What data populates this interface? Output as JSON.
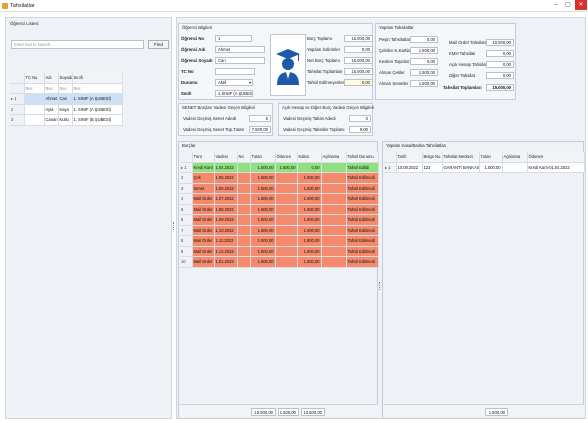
{
  "window": {
    "title": "Tahsilatlar",
    "minimize": "–",
    "maximize": "▢",
    "close": "✕"
  },
  "student_list": {
    "header": "Öğrenci Listesi",
    "search_placeholder": "Enter text to search...",
    "find_label": "Find",
    "columns": [
      "TC No",
      "Adı",
      "Soyadı",
      "Sınıfı"
    ],
    "filter_row": [
      "Rec",
      "Rec",
      "Rec",
      "Rec"
    ],
    "rows": [
      {
        "idx": "▸ 1",
        "tc": "",
        "ad": "Ahmet",
        "soyad": "Can",
        "sinif": "1. SINIF (A ŞUBESİ)"
      },
      {
        "idx": "2",
        "tc": "",
        "ad": "Ayla",
        "soyad": "Kaya",
        "sinif": "1. SINIF (A ŞUBESİ)"
      },
      {
        "idx": "3",
        "tc": "",
        "ad": "Canan",
        "soyad": "Kutlu",
        "sinif": "1. SINIF (B ŞUBESİ)"
      }
    ]
  },
  "student_info": {
    "header": "Öğrenci Bilgileri",
    "fields": [
      {
        "label": "Öğrenci No",
        "value": "1"
      },
      {
        "label": "Öğrenci Adı",
        "value": "Ahmet"
      },
      {
        "label": "Öğrenci Soyadı",
        "value": "Can"
      },
      {
        "label": "TC No",
        "value": ""
      },
      {
        "label": "Durumu",
        "value": "Aktif"
      },
      {
        "label": "Sınıfı",
        "value": "1.SINIF (A ŞUBESİ)"
      }
    ]
  },
  "debt_summary": [
    {
      "label": "Borç Toplamı",
      "value": "15.000,00"
    },
    {
      "label": "Yapılan İndirimler",
      "value": "0,00"
    },
    {
      "label": "Net Borç Toplamı",
      "value": "15.000,00"
    },
    {
      "label": "Tahsilat Toplamları",
      "value": "15.000,00"
    },
    {
      "label": "Tahsil Edilmeyenler",
      "value": "0,00"
    }
  ],
  "payments": {
    "header": "Yapılan Tahsilatlar",
    "left": [
      {
        "label": "Peşin Tahsilatlar",
        "value": "0,00"
      },
      {
        "label": "Çekilen K.Kartları",
        "value": "1.500,00"
      },
      {
        "label": "Kesilen Taşınlar",
        "value": "0,00"
      },
      {
        "label": "Alınan Çekler",
        "value": "1.500,00"
      },
      {
        "label": "Alınan Senetler",
        "value": "1.500,00"
      }
    ],
    "right": [
      {
        "label": "Mail Order Tahsilatı",
        "value": "10.500,00"
      },
      {
        "label": "KMH Tahsilatı",
        "value": "0,00"
      },
      {
        "label": "Açık Hesap Tahsilatı",
        "value": "0,00"
      },
      {
        "label": "Diğer Tahsilat",
        "value": "0,00"
      }
    ],
    "total_label": "Tahsilat Toplamları",
    "total_value": "15.000,00"
  },
  "senet": {
    "header": "SENET Borçları Vadesi Geçen Bilgileri",
    "rows": [
      {
        "label": "Vadesi Geçmiş Senet Adedi",
        "value": "5"
      },
      {
        "label": "Vadesi Geçmiş Senet Top.Tutarı",
        "value": "7.500,00"
      }
    ]
  },
  "open_account": {
    "header": "Açık Hesap ve Diğer Borç Vadesi Geçen Bilgileri",
    "rows": [
      {
        "label": "Vadesi Geçmiş Taksit Adedi",
        "value": "0"
      },
      {
        "label": "Vadesi Geçmiş Taksitler Toplamı",
        "value": "0,00"
      }
    ]
  },
  "debts": {
    "header": "Borçlar",
    "columns": [
      "Türü",
      "Vadesi",
      "No",
      "Tutarı",
      "Ödenen",
      "Kalan",
      "Açıklama",
      "Tahsil Durumu"
    ],
    "rows": [
      {
        "idx": "▸ 1",
        "tur": "Kredi Kartı",
        "vade": "1.04.2022",
        "no": "",
        "tutar": "1.500,00",
        "odenen": "1.500,00",
        "kalan": "0,00",
        "aciklama": "",
        "durum": "Tahsil Edildi",
        "status": "paid"
      },
      {
        "idx": "2",
        "tur": "Çek",
        "vade": "1.05.2022",
        "no": "",
        "tutar": "1.500,00",
        "odenen": "",
        "kalan": "1.500,00",
        "aciklama": "",
        "durum": "Tahsil Edilmedi",
        "status": "unpaid"
      },
      {
        "idx": "3",
        "tur": "Senet",
        "vade": "1.06.2022",
        "no": "",
        "tutar": "1.500,00",
        "odenen": "",
        "kalan": "1.500,00",
        "aciklama": "",
        "durum": "Tahsil Edilmedi",
        "status": "unpaid"
      },
      {
        "idx": "4",
        "tur": "Mail Order",
        "vade": "1.07.2022",
        "no": "",
        "tutar": "1.500,00",
        "odenen": "",
        "kalan": "1.500,00",
        "aciklama": "",
        "durum": "Tahsil Edilmedi",
        "status": "unpaid"
      },
      {
        "idx": "5",
        "tur": "Mail Order",
        "vade": "1.08.2022",
        "no": "",
        "tutar": "1.500,00",
        "odenen": "",
        "kalan": "1.500,00",
        "aciklama": "",
        "durum": "Tahsil Edilmedi",
        "status": "unpaid"
      },
      {
        "idx": "6",
        "tur": "Mail Order",
        "vade": "1.09.2022",
        "no": "",
        "tutar": "1.500,00",
        "odenen": "",
        "kalan": "1.500,00",
        "aciklama": "",
        "durum": "Tahsil Edilmedi",
        "status": "unpaid"
      },
      {
        "idx": "7",
        "tur": "Mail Order",
        "vade": "1.10.2022",
        "no": "",
        "tutar": "1.500,00",
        "odenen": "",
        "kalan": "1.500,00",
        "aciklama": "",
        "durum": "Tahsil Edilmedi",
        "status": "unpaid"
      },
      {
        "idx": "8",
        "tur": "Mail Order",
        "vade": "1.11.2022",
        "no": "",
        "tutar": "1.500,00",
        "odenen": "",
        "kalan": "1.500,00",
        "aciklama": "",
        "durum": "Tahsil Edilmedi",
        "status": "unpaid"
      },
      {
        "idx": "9",
        "tur": "Mail Order",
        "vade": "1.12.2022",
        "no": "",
        "tutar": "1.500,00",
        "odenen": "",
        "kalan": "1.500,00",
        "aciklama": "",
        "durum": "Tahsil Edilmedi",
        "status": "unpaid"
      },
      {
        "idx": "10",
        "tur": "Mail Order",
        "vade": "1.01.2023",
        "no": "",
        "tutar": "1.500,00",
        "odenen": "",
        "kalan": "1.500,00",
        "aciklama": "",
        "durum": "Tahsil Edilmedi",
        "status": "unpaid"
      }
    ],
    "footer": [
      "15.000,00",
      "1.500,00",
      "13.500,00"
    ]
  },
  "bank": {
    "header": "Yapılan Kasa/Banka Tahsilatları",
    "columns": [
      "Tarih",
      "Belge No",
      "Tahsilat Merkezi",
      "Tutarı",
      "Açıklama",
      "Ödenen"
    ],
    "rows": [
      {
        "idx": "▸ 1",
        "tarih": "10.09.2022",
        "belge": "123",
        "merkez": "GARANTİ BANKASI",
        "tutar": "1.500,00",
        "aciklama": "",
        "odenen": "Kredi Kartı-01.04.2022"
      }
    ],
    "footer": "1.500,00"
  },
  "icons": {
    "student_avatar": "graduate-icon",
    "dropdown": "chevron-down-icon"
  },
  "colors": {
    "paid_row": "#8fe07e",
    "unpaid_row": "#f4896b",
    "selected_row": "#cde0f5",
    "close_button": "#d9302a"
  }
}
